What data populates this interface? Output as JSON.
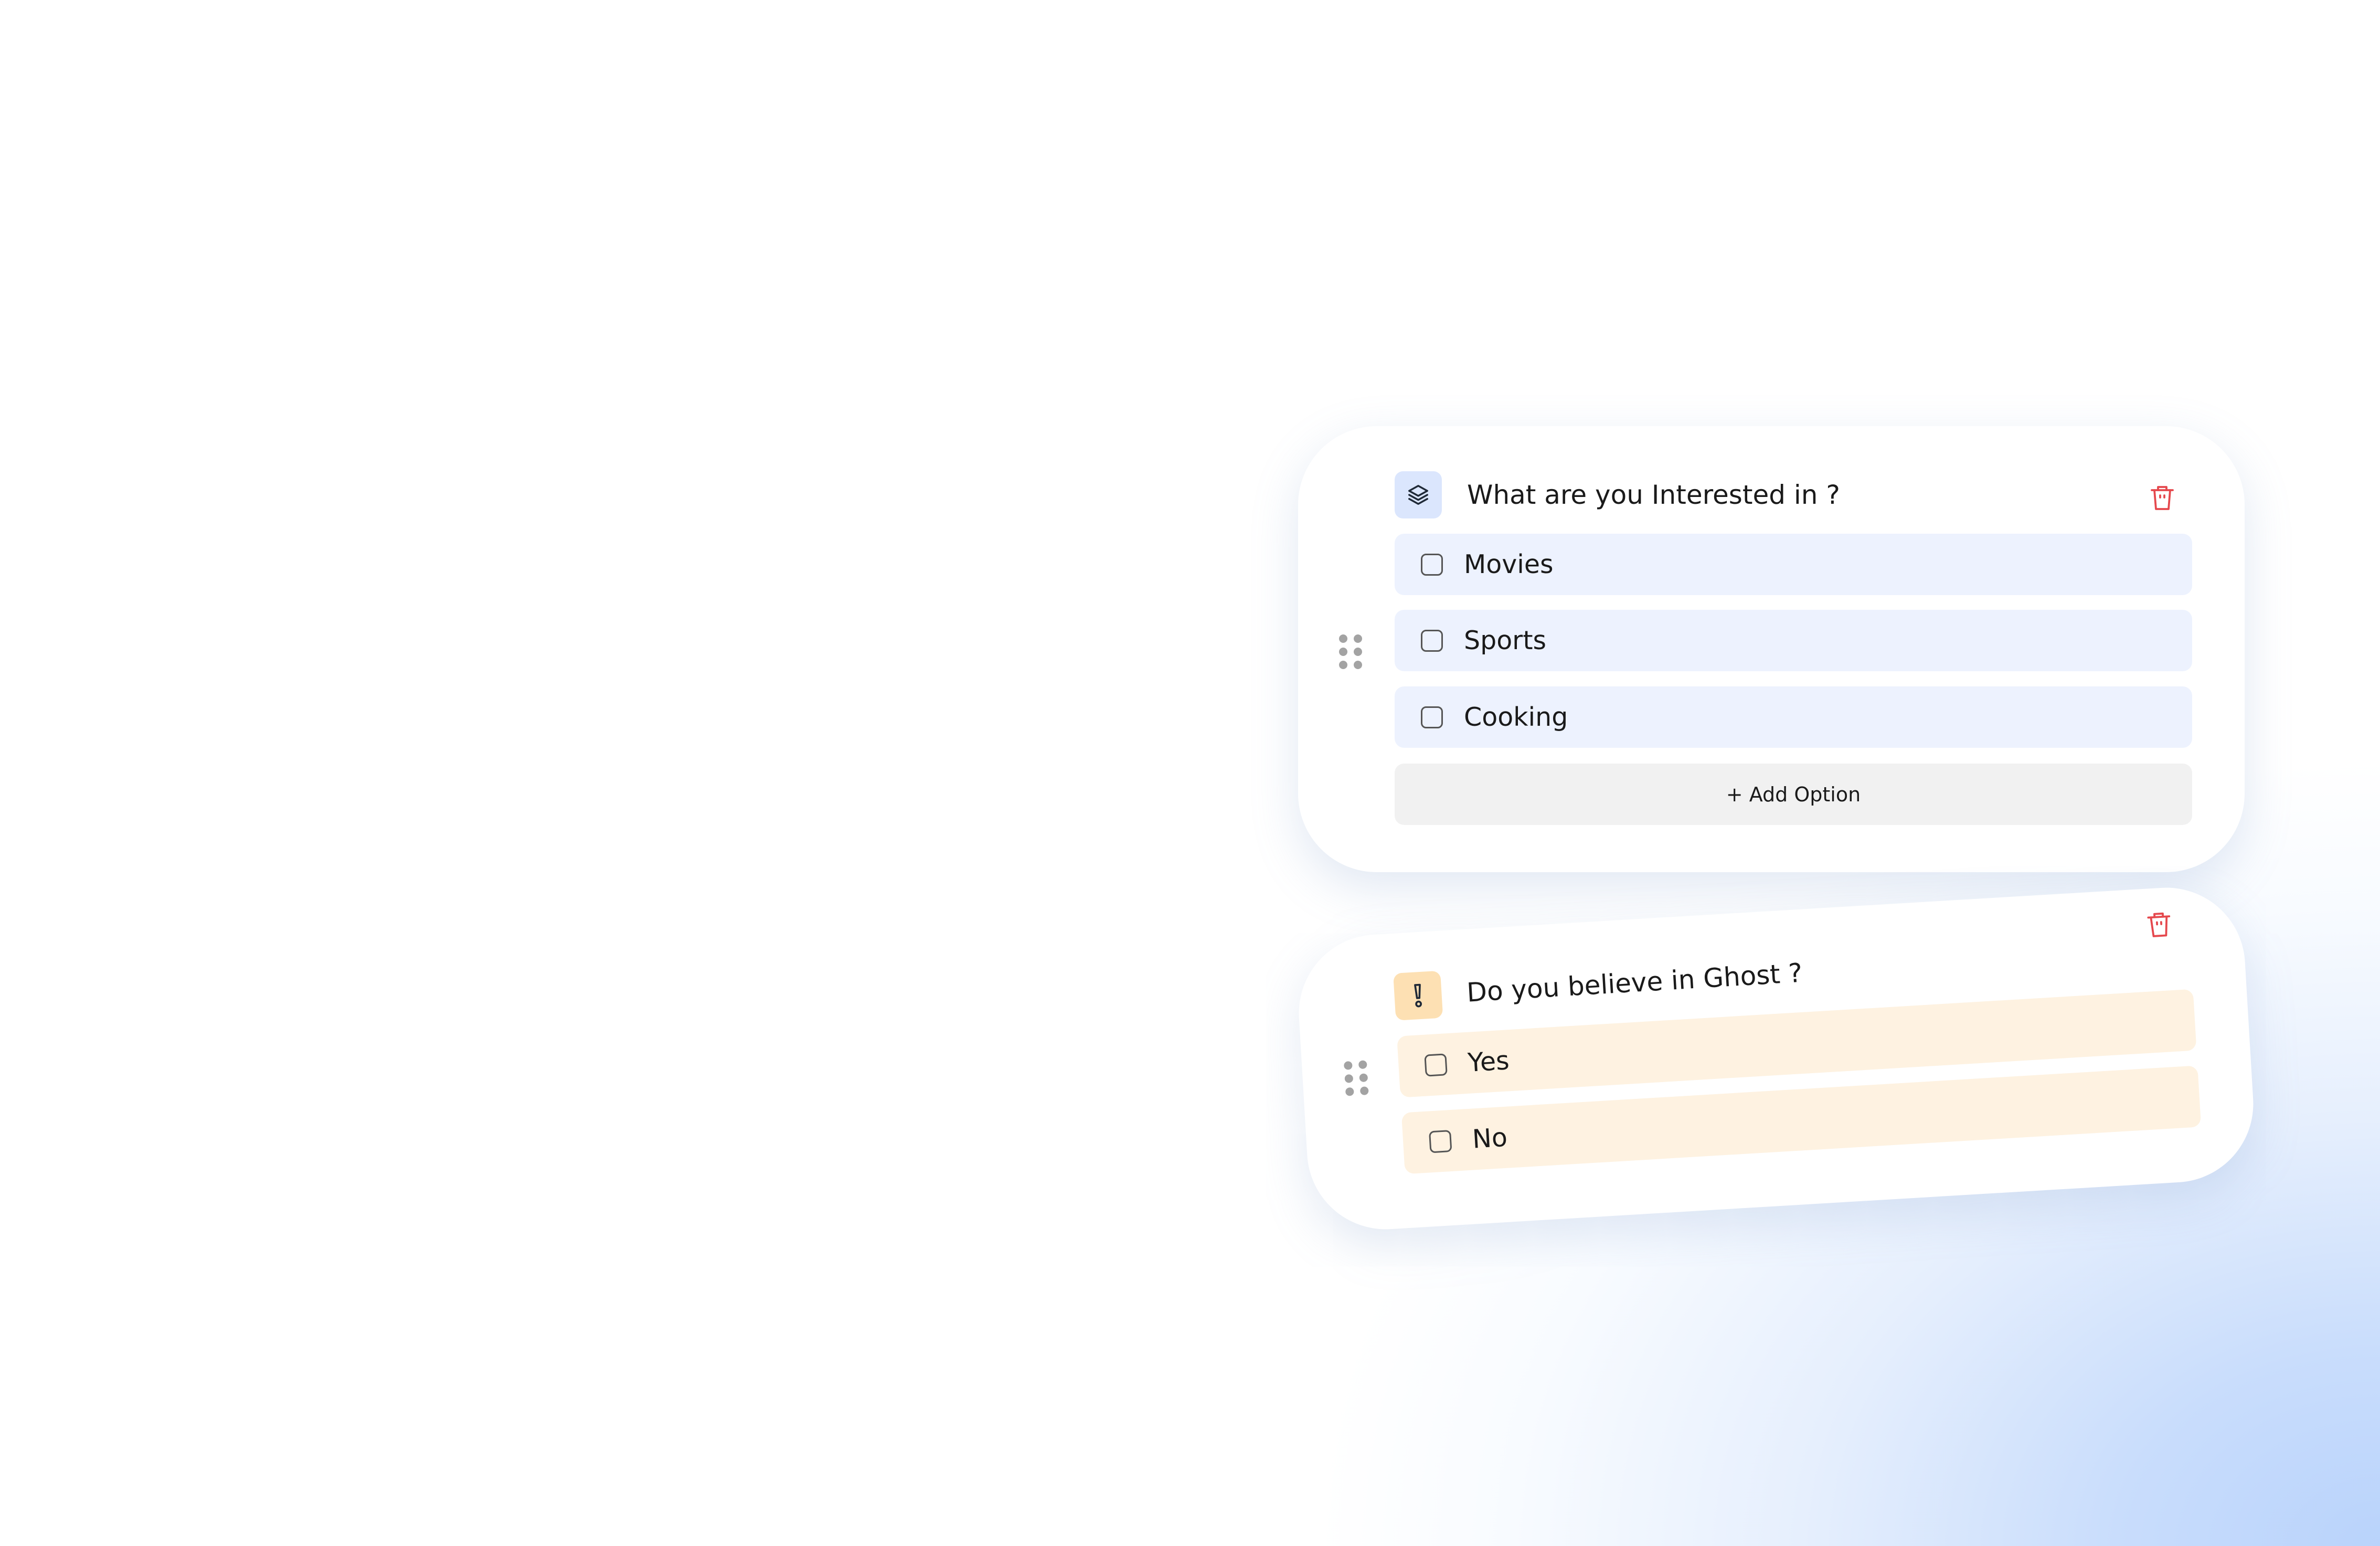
{
  "question1": {
    "icon": "layers-icon",
    "title": "What are you Interested in ?",
    "options": [
      {
        "label": "Movies",
        "checked": false
      },
      {
        "label": "Sports",
        "checked": false
      },
      {
        "label": "Cooking",
        "checked": false
      }
    ],
    "add_option_label": "+ Add Option",
    "accent_color": "#dbe6fd"
  },
  "question2": {
    "icon": "exclamation-icon",
    "title": "Do you believe in Ghost ?",
    "options": [
      {
        "label": "Yes",
        "checked": false
      },
      {
        "label": "No",
        "checked": false
      }
    ],
    "accent_color": "#fde0b3"
  },
  "colors": {
    "delete": "#e5484d",
    "option_blue": "#edf2fe",
    "option_orange": "#fef2e1",
    "background_glow": "#b9d3fb"
  }
}
